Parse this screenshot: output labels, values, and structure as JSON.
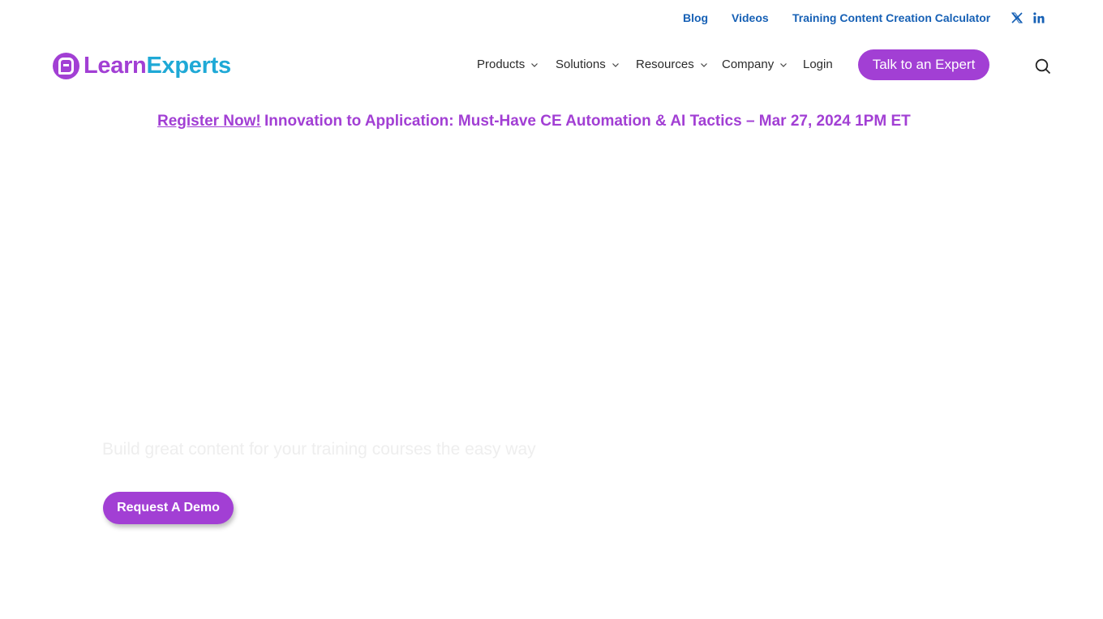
{
  "topbar": {
    "links": [
      "Blog",
      "Videos",
      "Training Content Creation Calculator"
    ],
    "social_icons": [
      "x-twitter-icon",
      "linkedin-icon"
    ]
  },
  "logo": {
    "learn": "Learn",
    "experts": "Experts"
  },
  "nav": {
    "items": [
      {
        "label": "Products",
        "dropdown": true
      },
      {
        "label": "Solutions",
        "dropdown": true
      },
      {
        "label": "Resources",
        "dropdown": true
      },
      {
        "label": "Company",
        "dropdown": true
      },
      {
        "label": "Login",
        "dropdown": false
      }
    ],
    "cta": "Talk to an Expert",
    "search_icon": "search-icon"
  },
  "announcement": {
    "register": "Register Now!",
    "event": "Innovation to Application: Must-Have CE Automation & AI Tactics – Mar 27, 2024 1PM ET"
  },
  "hero": {
    "subtitle": "Build great content for your training courses the easy way",
    "demo_button": "Request A Demo"
  },
  "colors": {
    "brand_purple": "#a23fd4",
    "brand_blue": "#1660b5",
    "logo_cyan": "#1fa9d6"
  }
}
